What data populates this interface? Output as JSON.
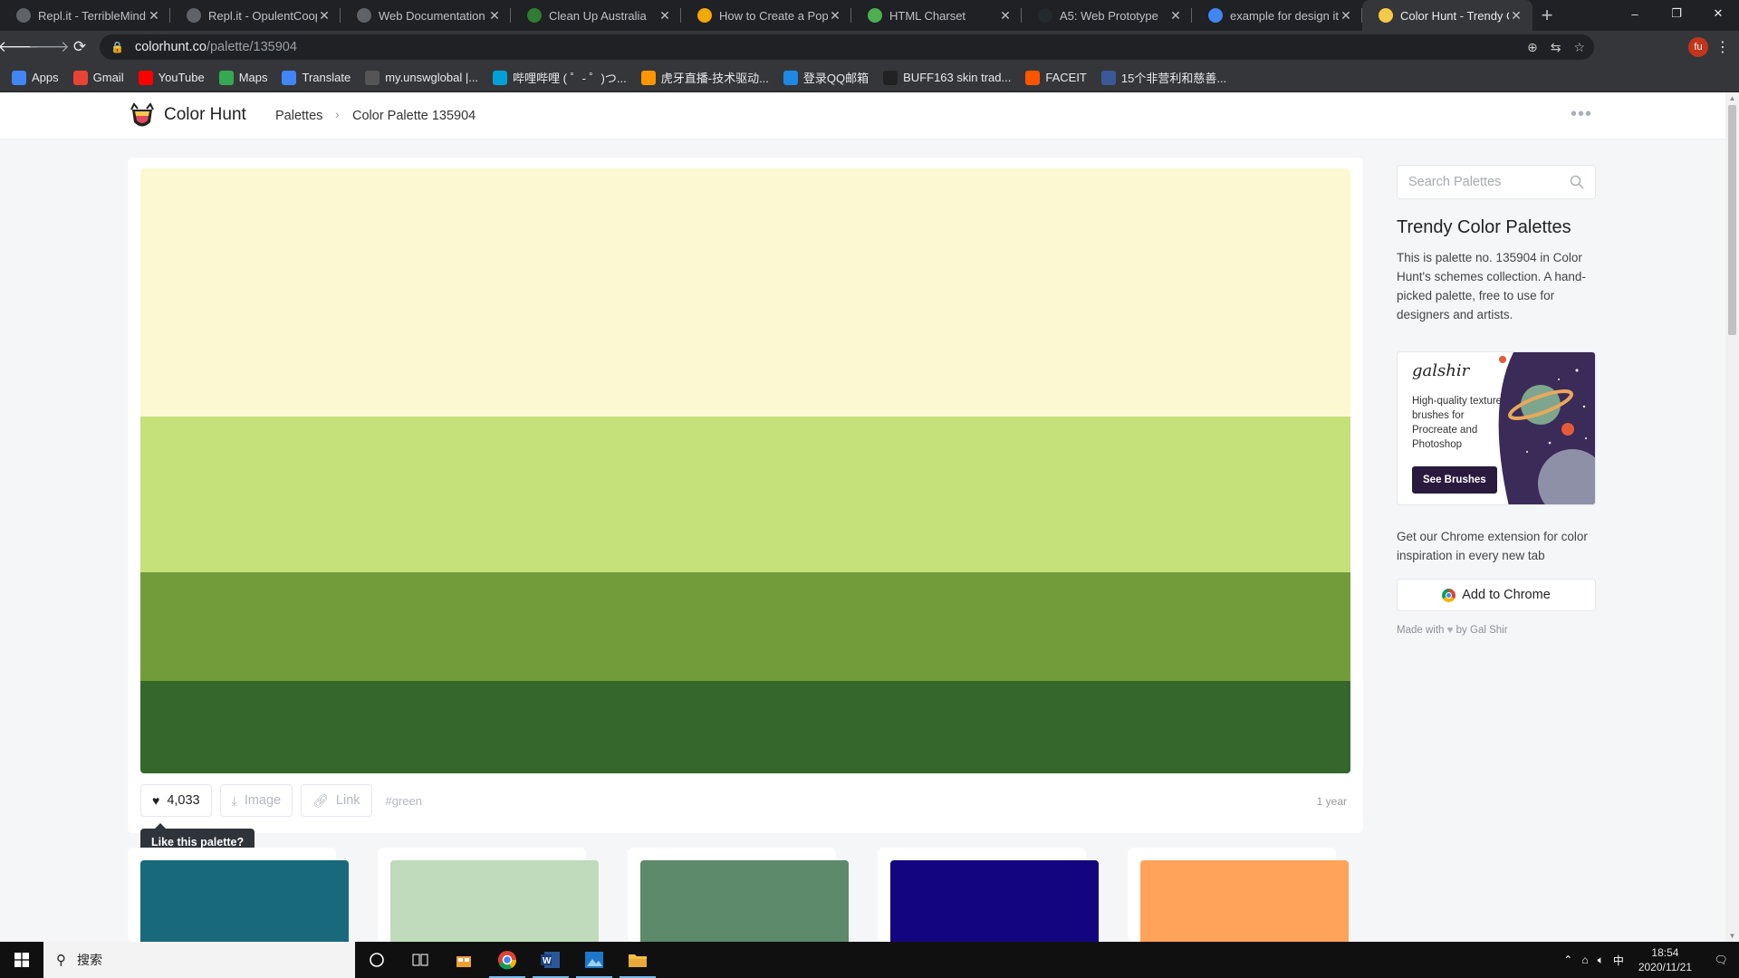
{
  "browser": {
    "tabs": [
      {
        "title": "Repl.it - TerribleMind",
        "favicon": "replit-icon",
        "color": "#5f6368"
      },
      {
        "title": "Repl.it - OpulentCoop",
        "favicon": "replit-icon",
        "color": "#5f6368"
      },
      {
        "title": "Web Documentation",
        "favicon": "globe-icon",
        "color": "#5f6368"
      },
      {
        "title": "Clean Up Australia",
        "favicon": "leaf-icon",
        "color": "#2e7d32"
      },
      {
        "title": "How to Create a Popu",
        "favicon": "question-icon",
        "color": "#f2a900"
      },
      {
        "title": "HTML Charset",
        "favicon": "w3-icon",
        "color": "#4caf50"
      },
      {
        "title": "A5: Web Prototype",
        "favicon": "github-icon",
        "color": "#24292e"
      },
      {
        "title": "example for design it",
        "favicon": "google-icon",
        "color": "#4285f4"
      },
      {
        "title": "Color Hunt - Trendy C",
        "favicon": "colorhunt-icon",
        "color": "#f7c948",
        "active": true
      }
    ],
    "new_tab": "+",
    "window_controls": {
      "minimize": "–",
      "restore": "❐",
      "close": "✕"
    },
    "url_host": "colorhunt.co",
    "url_path": "/palette/135904",
    "profile_initial": "fu",
    "bookmarks": [
      {
        "label": "Apps",
        "icon": "apps-grid-icon",
        "color": "#4285f4"
      },
      {
        "label": "Gmail",
        "icon": "google-icon",
        "color": "#ea4335"
      },
      {
        "label": "YouTube",
        "icon": "youtube-icon",
        "color": "#ff0000"
      },
      {
        "label": "Maps",
        "icon": "maps-pin-icon",
        "color": "#34a853"
      },
      {
        "label": "Translate",
        "icon": "translate-icon",
        "color": "#4285f4"
      },
      {
        "label": "my.unswglobal |...",
        "icon": "globe-icon",
        "color": "#555555"
      },
      {
        "label": "哔哩哔哩 ( ゜- ゜)つ...",
        "icon": "bilibili-icon",
        "color": "#00a1d6"
      },
      {
        "label": "虎牙直播-技术驱动...",
        "icon": "huya-icon",
        "color": "#ff9600"
      },
      {
        "label": "登录QQ邮箱",
        "icon": "qqmail-icon",
        "color": "#1e88e5"
      },
      {
        "label": "BUFF163 skin trad...",
        "icon": "buff-icon",
        "color": "#222222"
      },
      {
        "label": "FACEIT",
        "icon": "faceit-icon",
        "color": "#ff5500"
      },
      {
        "label": "15个非营利和慈善...",
        "icon": "bo-icon",
        "color": "#3b5998"
      }
    ]
  },
  "site": {
    "brand": "Color Hunt",
    "breadcrumb": [
      "Palettes",
      "Color Palette 135904"
    ],
    "breadcrumb_sep": "›",
    "menu_dots": "•••"
  },
  "palette": {
    "colors": [
      "#fcf8d2",
      "#c5e17a",
      "#729c3a",
      "#35672d"
    ],
    "likes": "4,033",
    "image_label": "Image",
    "link_label": "Link",
    "tag": "#green",
    "age": "1 year",
    "tooltip": "Like this palette?"
  },
  "more_palettes": [
    {
      "color": "#18697c"
    },
    {
      "color": "#bfdbbb"
    },
    {
      "color": "#5c8a6b"
    },
    {
      "color": "#13047f"
    },
    {
      "color": "#ffa25a"
    }
  ],
  "sidebar": {
    "search_placeholder": "Search Palettes",
    "title": "Trendy Color Palettes",
    "description": "This is palette no. 135904 in Color Hunt's schemes collection. A hand-picked palette, free to use for designers and artists.",
    "ad": {
      "script_logo": "galshir",
      "copy": "High-quality texture brushes for Procreate and Photoshop",
      "cta": "See Brushes"
    },
    "extension_text": "Get our Chrome extension for color inspiration in every new tab",
    "add_to_chrome": "Add to Chrome",
    "made_with_prefix": "Made with",
    "made_with_suffix": "by Gal Shir"
  },
  "taskbar": {
    "search_text": "搜索",
    "time": "18:54",
    "date": "2020/11/21"
  }
}
